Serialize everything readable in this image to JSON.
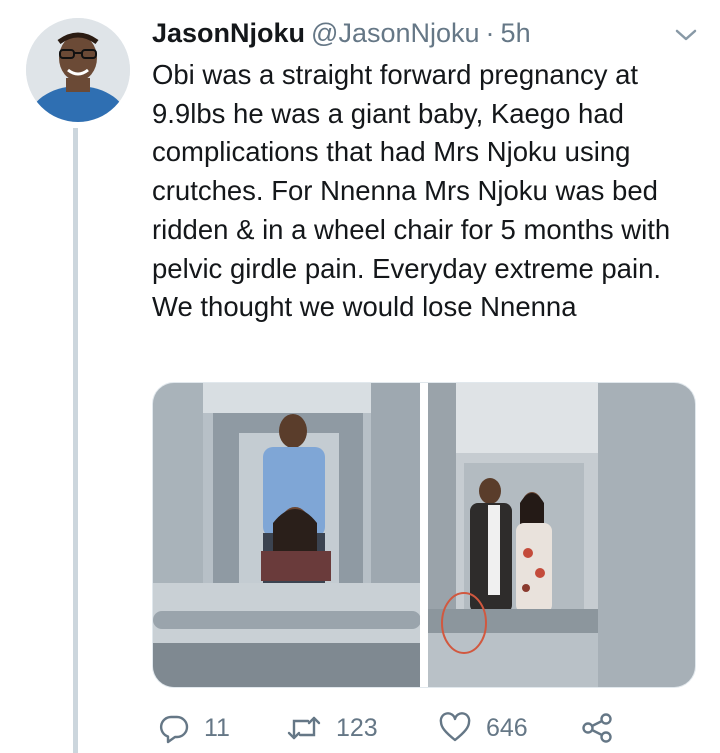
{
  "tweet": {
    "display_name": "JasonNjoku",
    "handle": "@JasonNjoku",
    "separator": "·",
    "timestamp": "5h",
    "text": "Obi was a straight forward pregnancy at 9.9lbs he was a giant baby, Kaego had complications that had Mrs Njoku using crutches. For Nnenna Mrs Njoku was bed ridden & in a wheel chair for 5 months with pelvic girdle pain. Everyday extreme pain. We thought we would lose Nnenna"
  },
  "media": {
    "count": 2
  },
  "actions": {
    "reply_count": "11",
    "retweet_count": "123",
    "like_count": "646"
  },
  "icons": {
    "caret": "chevron-down-icon",
    "reply": "reply-icon",
    "retweet": "retweet-icon",
    "like": "heart-icon",
    "share": "share-icon"
  },
  "colors": {
    "text_primary": "#14171a",
    "text_secondary": "#657786",
    "thread_line": "#ccd6dd"
  }
}
